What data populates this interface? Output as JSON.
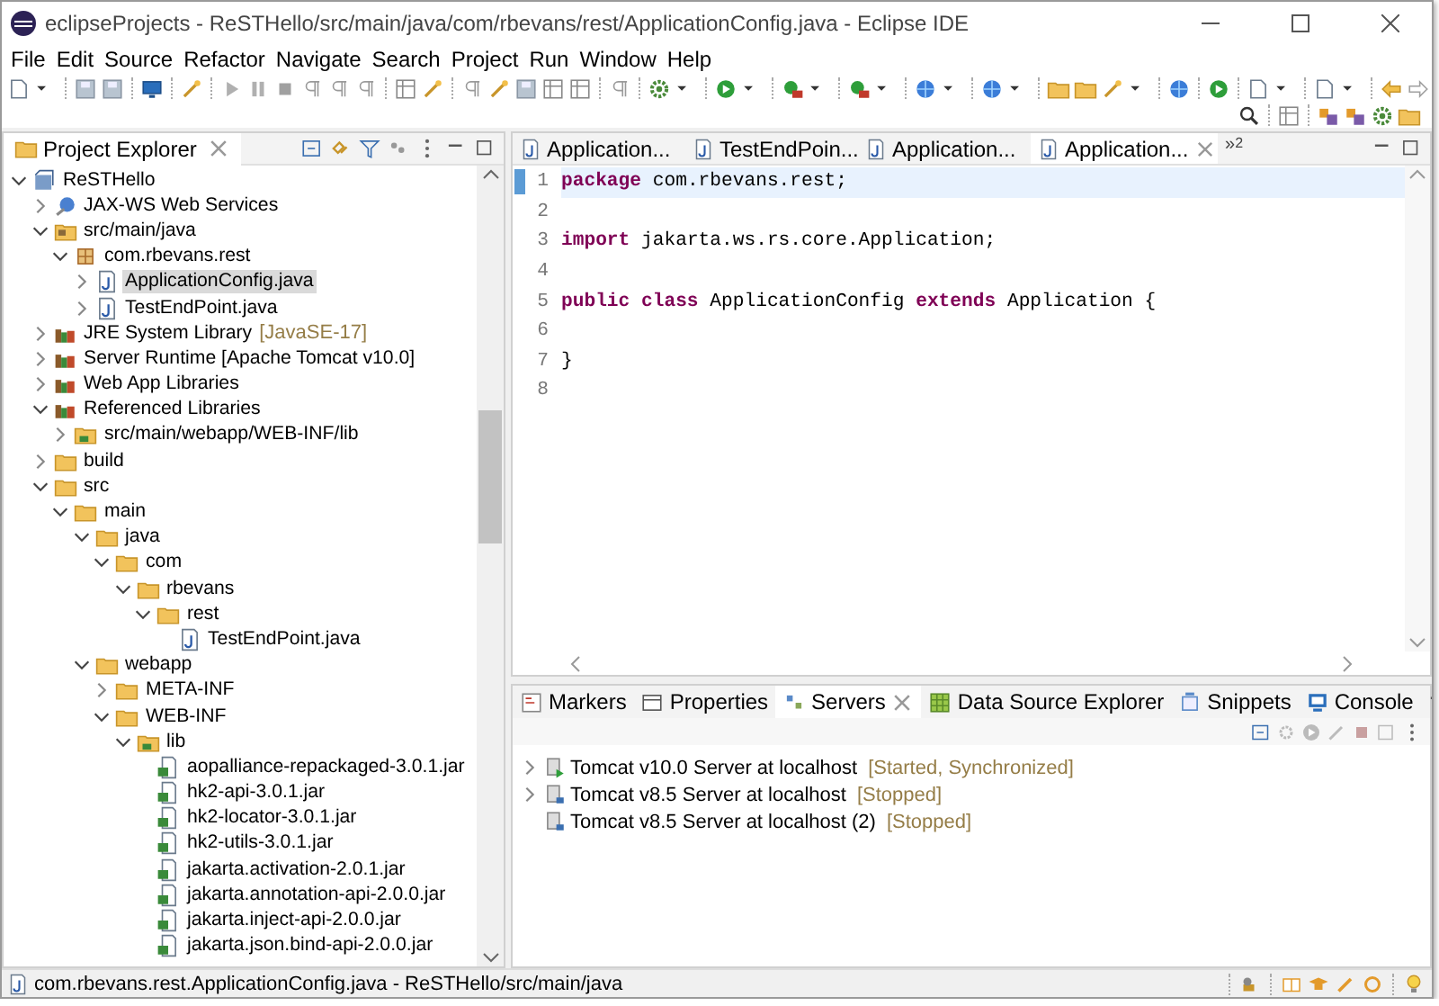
{
  "window": {
    "title": "eclipseProjects - ReSTHello/src/main/java/com/rbevans/rest/ApplicationConfig.java - Eclipse IDE"
  },
  "menu": [
    "File",
    "Edit",
    "Source",
    "Refactor",
    "Navigate",
    "Search",
    "Project",
    "Run",
    "Window",
    "Help"
  ],
  "project_explorer": {
    "title": "Project Explorer",
    "tree": [
      {
        "label": "ReSTHello",
        "kind": "project",
        "expanded": true,
        "selected": false,
        "children": [
          {
            "label": "JAX-WS Web Services",
            "kind": "service",
            "expanded": false,
            "selected": false
          },
          {
            "label": "src/main/java",
            "kind": "source",
            "expanded": true,
            "selected": false,
            "children": [
              {
                "label": "com.rbevans.rest",
                "kind": "package",
                "expanded": true,
                "selected": false,
                "children": [
                  {
                    "label": "ApplicationConfig.java",
                    "kind": "java",
                    "expanded": false,
                    "selected": true
                  },
                  {
                    "label": "TestEndPoint.java",
                    "kind": "java",
                    "expanded": false,
                    "selected": false
                  }
                ]
              }
            ]
          },
          {
            "label": "JRE System Library",
            "decoration": "[JavaSE-17]",
            "kind": "library",
            "expanded": false,
            "selected": false
          },
          {
            "label": "Server Runtime [Apache Tomcat v10.0]",
            "kind": "library",
            "expanded": false,
            "selected": false
          },
          {
            "label": "Web App Libraries",
            "kind": "library",
            "expanded": false,
            "selected": false
          },
          {
            "label": "Referenced Libraries",
            "kind": "library",
            "expanded": true,
            "selected": false,
            "children": [
              {
                "label": "src/main/webapp/WEB-INF/lib",
                "kind": "libfolder",
                "expanded": false,
                "selected": false
              }
            ]
          },
          {
            "label": "build",
            "kind": "folder",
            "expanded": false,
            "selected": false
          },
          {
            "label": "src",
            "kind": "folder",
            "expanded": true,
            "selected": false,
            "children": [
              {
                "label": "main",
                "kind": "folder",
                "expanded": true,
                "selected": false,
                "children": [
                  {
                    "label": "java",
                    "kind": "folder",
                    "expanded": true,
                    "selected": false,
                    "children": [
                      {
                        "label": "com",
                        "kind": "folder",
                        "expanded": true,
                        "selected": false,
                        "children": [
                          {
                            "label": "rbevans",
                            "kind": "folder",
                            "expanded": true,
                            "selected": false,
                            "children": [
                              {
                                "label": "rest",
                                "kind": "folder",
                                "expanded": true,
                                "selected": false,
                                "children": [
                                  {
                                    "label": "TestEndPoint.java",
                                    "kind": "java",
                                    "selected": false
                                  }
                                ]
                              }
                            ]
                          }
                        ]
                      }
                    ]
                  },
                  {
                    "label": "webapp",
                    "kind": "folder",
                    "expanded": true,
                    "selected": false,
                    "children": [
                      {
                        "label": "META-INF",
                        "kind": "folder",
                        "expanded": false,
                        "selected": false
                      },
                      {
                        "label": "WEB-INF",
                        "kind": "folder",
                        "expanded": true,
                        "selected": false,
                        "children": [
                          {
                            "label": "lib",
                            "kind": "libfolder",
                            "expanded": true,
                            "selected": false,
                            "children": [
                              {
                                "label": "aopalliance-repackaged-3.0.1.jar",
                                "kind": "jar",
                                "selected": false
                              },
                              {
                                "label": "hk2-api-3.0.1.jar",
                                "kind": "jar",
                                "selected": false
                              },
                              {
                                "label": "hk2-locator-3.0.1.jar",
                                "kind": "jar",
                                "selected": false
                              },
                              {
                                "label": "hk2-utils-3.0.1.jar",
                                "kind": "jar",
                                "selected": false
                              },
                              {
                                "label": "jakarta.activation-2.0.1.jar",
                                "kind": "jar",
                                "selected": false
                              },
                              {
                                "label": "jakarta.annotation-api-2.0.0.jar",
                                "kind": "jar",
                                "selected": false
                              },
                              {
                                "label": "jakarta.inject-api-2.0.0.jar",
                                "kind": "jar",
                                "selected": false
                              },
                              {
                                "label": "jakarta.json.bind-api-2.0.0.jar",
                                "kind": "jar",
                                "selected": false
                              }
                            ]
                          }
                        ]
                      }
                    ]
                  }
                ]
              }
            ]
          }
        ]
      }
    ]
  },
  "editor": {
    "tabs": [
      {
        "label": "Application...",
        "selected": false
      },
      {
        "label": "TestEndPoin...",
        "selected": false
      },
      {
        "label": "Application...",
        "selected": false
      },
      {
        "label": "Application...",
        "selected": true
      }
    ],
    "overflow": "»",
    "hidden_count": "2",
    "lines": [
      {
        "number": "1",
        "current": true,
        "tokens": [
          {
            "text": "package",
            "kind": "keyword"
          },
          {
            "text": " com.rbevans.rest;",
            "kind": "plain"
          }
        ]
      },
      {
        "number": "2",
        "current": false
      },
      {
        "number": "3",
        "current": false,
        "tokens": [
          {
            "text": "import",
            "kind": "keyword"
          },
          {
            "text": " jakarta.ws.rs.core.Application;",
            "kind": "plain"
          }
        ]
      },
      {
        "number": "4",
        "current": false
      },
      {
        "number": "5",
        "current": false,
        "tokens": [
          {
            "text": "public class",
            "kind": "keyword"
          },
          {
            "text": " ApplicationConfig ",
            "kind": "plain"
          },
          {
            "text": "extends",
            "kind": "keyword"
          },
          {
            "text": " Application {",
            "kind": "plain"
          }
        ]
      },
      {
        "number": "6",
        "current": false
      },
      {
        "number": "7",
        "current": false,
        "tokens": [
          {
            "text": "}",
            "kind": "plain"
          }
        ]
      },
      {
        "number": "8",
        "current": false
      }
    ]
  },
  "bottom_panel": {
    "tabs": [
      {
        "label": "Markers",
        "kind": "markers",
        "selected": false
      },
      {
        "label": "Properties",
        "kind": "properties",
        "selected": false
      },
      {
        "label": "Servers",
        "kind": "servers",
        "selected": true
      },
      {
        "label": "Data Source Explorer",
        "kind": "datasource",
        "selected": false
      },
      {
        "label": "Snippets",
        "kind": "snippets",
        "selected": false
      },
      {
        "label": "Console",
        "kind": "console",
        "selected": false
      }
    ],
    "servers": [
      {
        "name": "Tomcat v10.0 Server at localhost",
        "status": "[Started, Synchronized]",
        "running": true,
        "expanded": false
      },
      {
        "name": "Tomcat v8.5 Server at localhost",
        "status": "[Stopped]",
        "running": false,
        "expanded": false
      },
      {
        "name": "Tomcat v8.5 Server at localhost (2)",
        "status": "[Stopped]",
        "running": false
      }
    ]
  },
  "status_bar": {
    "text": "com.rbevans.rest.ApplicationConfig.java - ReSTHello/src/main/java"
  }
}
